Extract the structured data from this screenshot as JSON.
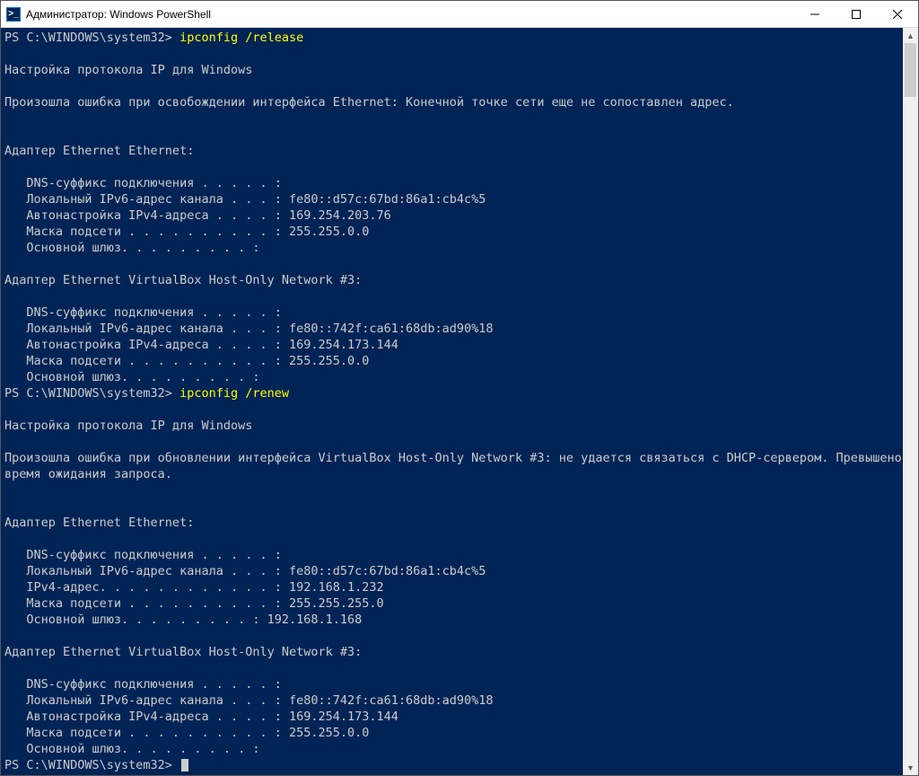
{
  "window": {
    "title": "Администратор: Windows PowerShell"
  },
  "prompt": "PS C:\\WINDOWS\\system32>",
  "commands": {
    "release": "ipconfig /release",
    "renew": "ipconfig /renew"
  },
  "output": {
    "ipconfig_header": "Настройка протокола IP для Windows",
    "release_error": "Произошла ошибка при освобождении интерфейса Ethernet: Конечной точке сети еще не сопоставлен адрес.",
    "renew_error": "Произошла ошибка при обновлении интерфейса VirtualBox Host-Only Network #3: не удается связаться с DHCP-сервером. Превышено\nвремя ожидания запроса.",
    "adapter_eth_header": "Адаптер Ethernet Ethernet:",
    "adapter_vbox_header": "Адаптер Ethernet VirtualBox Host-Only Network #3:",
    "eth_release": {
      "dns_suffix": "   DNS-суффикс подключения . . . . . :",
      "ipv6_local": "   Локальный IPv6-адрес канала . . . : fe80::d57c:67bd:86a1:cb4c%5",
      "ipv4_auto": "   Автонастройка IPv4-адреса . . . . : 169.254.203.76",
      "subnet_mask": "   Маска подсети . . . . . . . . . . : 255.255.0.0",
      "gateway": "   Основной шлюз. . . . . . . . . :"
    },
    "vbox_release": {
      "dns_suffix": "   DNS-суффикс подключения . . . . . :",
      "ipv6_local": "   Локальный IPv6-адрес канала . . . : fe80::742f:ca61:68db:ad90%18",
      "ipv4_auto": "   Автонастройка IPv4-адреса . . . . : 169.254.173.144",
      "subnet_mask": "   Маска подсети . . . . . . . . . . : 255.255.0.0",
      "gateway": "   Основной шлюз. . . . . . . . . :"
    },
    "eth_renew": {
      "dns_suffix": "   DNS-суффикс подключения . . . . . :",
      "ipv6_local": "   Локальный IPv6-адрес канала . . . : fe80::d57c:67bd:86a1:cb4c%5",
      "ipv4_addr": "   IPv4-адрес. . . . . . . . . . . . : 192.168.1.232",
      "subnet_mask": "   Маска подсети . . . . . . . . . . : 255.255.255.0",
      "gateway": "   Основной шлюз. . . . . . . . . : 192.168.1.168"
    },
    "vbox_renew": {
      "dns_suffix": "   DNS-суффикс подключения . . . . . :",
      "ipv6_local": "   Локальный IPv6-адрес канала . . . : fe80::742f:ca61:68db:ad90%18",
      "ipv4_auto": "   Автонастройка IPv4-адреса . . . . : 169.254.173.144",
      "subnet_mask": "   Маска подсети . . . . . . . . . . : 255.255.0.0",
      "gateway": "   Основной шлюз. . . . . . . . . :"
    }
  }
}
